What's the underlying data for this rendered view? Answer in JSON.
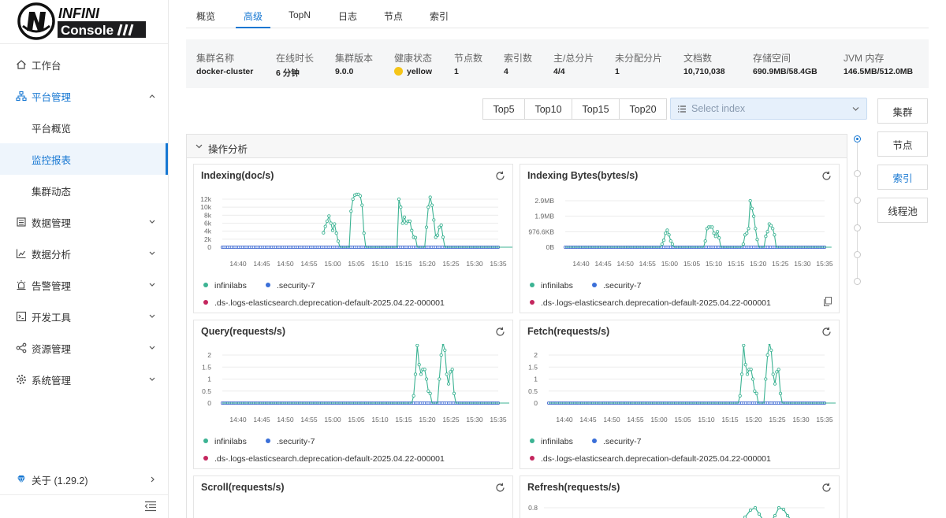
{
  "logo": {
    "text_top": "INFINI",
    "text_bottom": "Console"
  },
  "sidebar": {
    "items": [
      {
        "label": "工作台",
        "icon": "home-icon"
      },
      {
        "label": "平台管理",
        "icon": "cluster-icon",
        "expanded": true
      },
      {
        "label": "平台概览",
        "sub": true
      },
      {
        "label": "监控报表",
        "sub": true,
        "active": true
      },
      {
        "label": "集群动态",
        "sub": true
      },
      {
        "label": "数据管理",
        "icon": "database-icon"
      },
      {
        "label": "数据分析",
        "icon": "chart-icon"
      },
      {
        "label": "告警管理",
        "icon": "alarm-icon"
      },
      {
        "label": "开发工具",
        "icon": "code-icon"
      },
      {
        "label": "资源管理",
        "icon": "share-icon"
      },
      {
        "label": "系统管理",
        "icon": "gear-icon"
      }
    ],
    "about": "关于 (1.29.2)"
  },
  "tabs": [
    "概览",
    "高级",
    "TopN",
    "日志",
    "节点",
    "索引"
  ],
  "active_tab": "高级",
  "cluster_info": [
    {
      "key": "集群名称",
      "value": "docker-cluster"
    },
    {
      "key": "在线时长",
      "value": "6 分钟"
    },
    {
      "key": "集群版本",
      "value": "9.0.0"
    },
    {
      "key": "健康状态",
      "value": "yellow"
    },
    {
      "key": "节点数",
      "value": "1"
    },
    {
      "key": "索引数",
      "value": "4"
    },
    {
      "key": "主/总分片",
      "value": "4/4"
    },
    {
      "key": "未分配分片",
      "value": "1"
    },
    {
      "key": "文档数",
      "value": "10,710,038"
    },
    {
      "key": "存储空间",
      "value": "690.9MB/58.4GB"
    },
    {
      "key": "JVM 内存",
      "value": "146.5MB/512.0MB"
    }
  ],
  "colors": {
    "accent": "#1677d2",
    "health": "#f5c518",
    "series_infinilabs": "#3cb393",
    "series_security": "#3a6fd8",
    "series_ds": "#c4265e"
  },
  "top_buttons": [
    "Top5",
    "Top10",
    "Top15",
    "Top20"
  ],
  "index_select": {
    "placeholder": "Select index"
  },
  "right_nav": [
    "集群",
    "节点",
    "索引",
    "线程池"
  ],
  "right_nav_active": "索引",
  "panel_title": "操作分析",
  "legend": [
    "infinilabs",
    ".security-7",
    ".ds-.logs-elasticsearch.deprecation-default-2025.04.22-000001"
  ],
  "chart_data": [
    {
      "type": "line",
      "title": "Indexing(doc/s)",
      "x": [
        "14:40",
        "14:45",
        "14:50",
        "14:55",
        "15:00",
        "15:05",
        "15:10",
        "15:15",
        "15:20",
        "15:25",
        "15:30",
        "15:35"
      ],
      "yticks": [
        "12k",
        "10k",
        "8k",
        "6k",
        "4k",
        "2k",
        "0"
      ],
      "ylim": [
        0,
        12000
      ],
      "series": [
        {
          "name": "infinilabs",
          "values": [
            null,
            null,
            null,
            null,
            null,
            null,
            null,
            null,
            null,
            null,
            null,
            null,
            null,
            null,
            null,
            null,
            null,
            null,
            null,
            null,
            null,
            null,
            null,
            null,
            null,
            null,
            null,
            null,
            null,
            null,
            null,
            null,
            null,
            null,
            null,
            null,
            null,
            null,
            null,
            null,
            null,
            null,
            null,
            null,
            null,
            null,
            null,
            null,
            null,
            null,
            null,
            null,
            null,
            null,
            null,
            3600,
            5200,
            6500,
            7800,
            6000,
            4200,
            5800,
            3500,
            1500,
            0,
            0,
            0,
            0,
            0,
            0,
            9000,
            12000,
            13000,
            13200,
            13200,
            12800,
            10500,
            3500,
            0,
            0,
            0,
            0,
            0,
            0,
            0,
            0,
            0,
            0,
            0,
            0,
            0,
            0,
            0,
            0,
            0,
            0,
            12000,
            10000,
            6000,
            7500,
            6000,
            6500,
            6500,
            4200,
            2500,
            2400,
            0,
            0,
            0,
            0,
            0,
            5000,
            10000,
            12500,
            10500,
            6800,
            2500,
            3000,
            5000,
            5500,
            2500,
            0,
            0,
            0,
            0,
            0,
            0,
            0,
            0,
            0,
            0,
            0,
            0,
            0,
            0,
            0,
            0,
            0,
            0,
            0,
            0,
            0,
            0,
            0,
            0,
            0,
            0,
            0,
            0,
            0,
            0,
            0,
            0,
            0,
            0,
            0,
            0,
            0,
            0,
            0,
            0,
            0,
            0,
            0,
            0
          ]
        },
        {
          "name": ".security-7",
          "values": "zeros"
        },
        {
          "name": ".ds-.logs-elasticsearch.deprecation-default-2025.04.22-000001",
          "values": "zeros"
        }
      ]
    },
    {
      "type": "line",
      "title": "Indexing Bytes(bytes/s)",
      "x": [
        "14:40",
        "14:45",
        "14:50",
        "14:55",
        "15:00",
        "15:05",
        "15:10",
        "15:15",
        "15:20",
        "15:25",
        "15:30",
        "15:35"
      ],
      "yticks": [
        "2.9MB",
        "1.9MB",
        "976.6KB",
        "0B"
      ],
      "ylim": [
        0,
        3000000
      ],
      "series": [
        {
          "name": "infinilabs",
          "values": [
            0,
            0,
            0,
            0,
            0,
            0,
            0,
            0,
            0,
            0,
            0,
            0,
            0,
            0,
            0,
            0,
            0,
            0,
            0,
            0,
            0,
            0,
            0,
            0,
            0,
            0,
            0,
            0,
            0,
            0,
            0,
            0,
            0,
            0,
            0,
            0,
            0,
            0,
            0,
            0,
            0,
            0,
            0,
            0,
            0,
            0,
            0,
            0,
            0,
            0,
            0,
            0,
            0,
            0,
            0,
            0,
            200000,
            450000,
            900000,
            1100000,
            800000,
            400000,
            200000,
            0,
            0,
            0,
            0,
            0,
            0,
            0,
            0,
            0,
            0,
            0,
            0,
            0,
            0,
            0,
            0,
            0,
            0,
            400000,
            1200000,
            1300000,
            1300000,
            1300000,
            900000,
            700000,
            1000000,
            600000,
            0,
            0,
            0,
            0,
            0,
            0,
            0,
            0,
            0,
            0,
            0,
            0,
            0,
            200000,
            800000,
            900000,
            1200000,
            3000000,
            2500000,
            2000000,
            1200000,
            500000,
            0,
            0,
            0,
            0,
            700000,
            1000000,
            1500000,
            1400000,
            1200000,
            800000,
            0,
            0,
            0,
            0,
            0,
            0,
            0,
            0,
            0,
            0,
            0,
            0,
            0,
            0,
            0,
            0,
            0,
            0,
            0,
            0,
            0,
            0,
            0,
            0,
            0,
            0,
            0,
            0,
            0,
            0,
            0,
            0,
            0
          ]
        },
        {
          "name": ".security-7",
          "values": "zeros"
        },
        {
          "name": ".ds-.logs-elasticsearch.deprecation-default-2025.04.22-000001",
          "values": "zeros"
        }
      ]
    },
    {
      "type": "line",
      "title": "Query(requests/s)",
      "x": [
        "14:40",
        "14:45",
        "14:50",
        "14:55",
        "15:00",
        "15:05",
        "15:10",
        "15:15",
        "15:20",
        "15:25",
        "15:30",
        "15:35"
      ],
      "yticks": [
        "2",
        "1.5",
        "1",
        "0.5",
        "0"
      ],
      "ylim": [
        0,
        2
      ],
      "series": [
        {
          "name": "infinilabs",
          "values": [
            0,
            0,
            0,
            0,
            0,
            0,
            0,
            0,
            0,
            0,
            0,
            0,
            0,
            0,
            0,
            0,
            0,
            0,
            0,
            0,
            0,
            0,
            0,
            0,
            0,
            0,
            0,
            0,
            0,
            0,
            0,
            0,
            0,
            0,
            0,
            0,
            0,
            0,
            0,
            0,
            0,
            0,
            0,
            0,
            0,
            0,
            0,
            0,
            0,
            0,
            0,
            0,
            0,
            0,
            0,
            0,
            0,
            0,
            0,
            0,
            0,
            0,
            0,
            0,
            0,
            0,
            0,
            0,
            0,
            0,
            0,
            0,
            0,
            0,
            0,
            0,
            0,
            0,
            0,
            0,
            0,
            0,
            0,
            0,
            0,
            0,
            0,
            0,
            0,
            0,
            0,
            0,
            0,
            0,
            0,
            0,
            0,
            0,
            0,
            0,
            0,
            0,
            0,
            0,
            0.3,
            1.2,
            2.4,
            1.6,
            1.2,
            1.4,
            1.4,
            1.0,
            0.5,
            0.4,
            0,
            0,
            0,
            0,
            1.0,
            2.0,
            2.5,
            2.2,
            1.2,
            0.8,
            1.3,
            1.4,
            0.4,
            0,
            0,
            0,
            0,
            0,
            0,
            0,
            0,
            0,
            0,
            0,
            0,
            0,
            0,
            0,
            0,
            0,
            0,
            0,
            0,
            0,
            0,
            0,
            0,
            0,
            0,
            0,
            0,
            0,
            0
          ]
        },
        {
          "name": ".security-7",
          "values": "zeros"
        },
        {
          "name": ".ds-.logs-elasticsearch.deprecation-default-2025.04.22-000001",
          "values": "zeros"
        }
      ]
    },
    {
      "type": "line",
      "title": "Fetch(requests/s)",
      "x": [
        "14:40",
        "14:45",
        "14:50",
        "14:55",
        "15:00",
        "15:05",
        "15:10",
        "15:15",
        "15:20",
        "15:25",
        "15:30",
        "15:35"
      ],
      "yticks": [
        "2",
        "1.5",
        "1",
        "0.5",
        "0"
      ],
      "ylim": [
        0,
        2
      ],
      "series": [
        {
          "name": "infinilabs",
          "values": [
            0,
            0,
            0,
            0,
            0,
            0,
            0,
            0,
            0,
            0,
            0,
            0,
            0,
            0,
            0,
            0,
            0,
            0,
            0,
            0,
            0,
            0,
            0,
            0,
            0,
            0,
            0,
            0,
            0,
            0,
            0,
            0,
            0,
            0,
            0,
            0,
            0,
            0,
            0,
            0,
            0,
            0,
            0,
            0,
            0,
            0,
            0,
            0,
            0,
            0,
            0,
            0,
            0,
            0,
            0,
            0,
            0,
            0,
            0,
            0,
            0,
            0,
            0,
            0,
            0,
            0,
            0,
            0,
            0,
            0,
            0,
            0,
            0,
            0,
            0,
            0,
            0,
            0,
            0,
            0,
            0,
            0,
            0,
            0,
            0,
            0,
            0,
            0,
            0,
            0,
            0,
            0,
            0,
            0,
            0,
            0,
            0,
            0,
            0,
            0,
            0,
            0,
            0,
            0,
            0.3,
            1.2,
            2.4,
            1.6,
            1.2,
            1.4,
            1.4,
            1.0,
            0.5,
            0.4,
            0,
            0,
            0,
            0,
            1.0,
            2.0,
            2.5,
            2.2,
            1.2,
            0.8,
            1.3,
            1.4,
            0.4,
            0,
            0,
            0,
            0,
            0,
            0,
            0,
            0,
            0,
            0,
            0,
            0,
            0,
            0,
            0,
            0,
            0,
            0,
            0,
            0,
            0,
            0,
            0,
            0,
            0,
            0,
            0,
            0,
            0,
            0
          ]
        },
        {
          "name": ".security-7",
          "values": "zeros"
        },
        {
          "name": ".ds-.logs-elasticsearch.deprecation-default-2025.04.22-000001",
          "values": "zeros"
        }
      ]
    },
    {
      "type": "line",
      "title": "Scroll(requests/s)",
      "x": [],
      "yticks": [],
      "series": []
    },
    {
      "type": "line",
      "title": "Refresh(requests/s)",
      "x": [],
      "yticks": [
        "0.8"
      ],
      "ylim": [
        0,
        0.8
      ],
      "series": []
    }
  ]
}
